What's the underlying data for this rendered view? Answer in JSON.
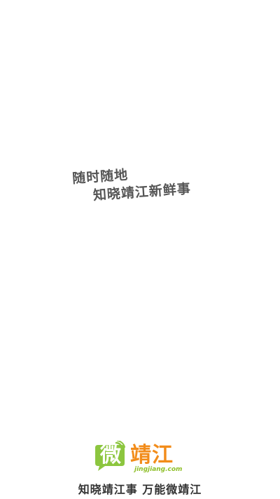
{
  "slogan": {
    "line1": "随时随地",
    "line2": "知晓靖江新鲜事"
  },
  "logo": {
    "badge_char": "微",
    "name": "靖江",
    "domain": "jingjiang.com",
    "icon": "speech-bubble-icon",
    "colors": {
      "badge_green": "#8cc63f",
      "name_orange": "#f28c1a"
    }
  },
  "tagline": "知晓靖江事 万能微靖江"
}
